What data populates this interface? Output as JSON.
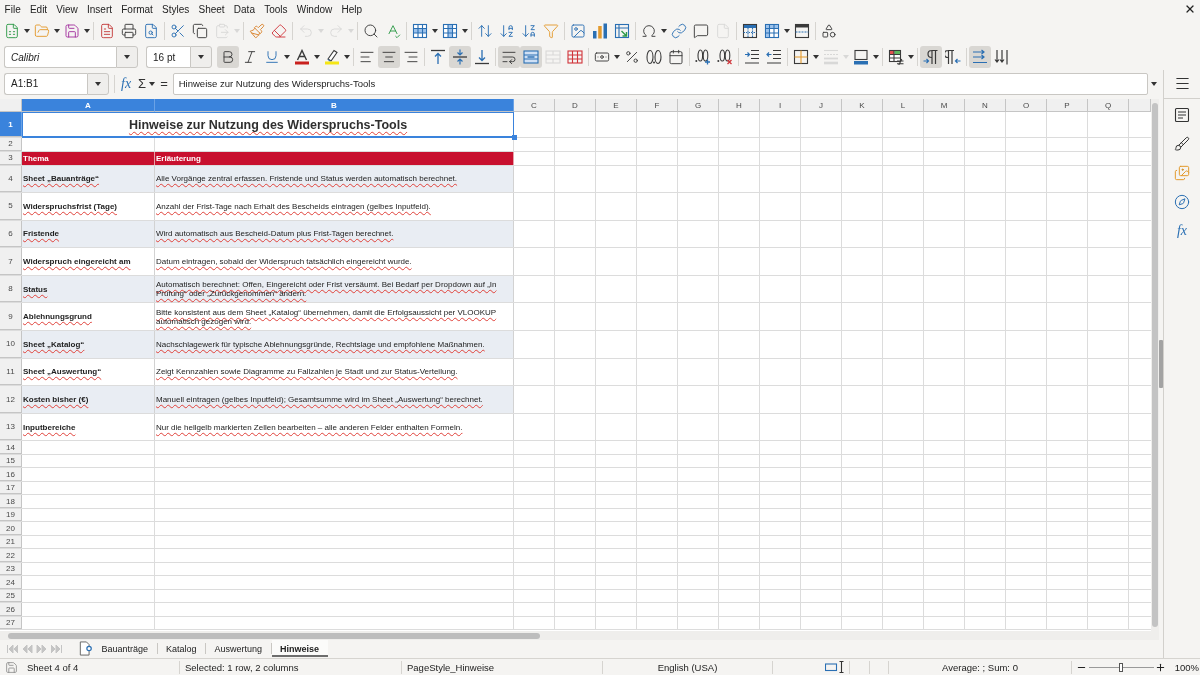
{
  "menu_bar": [
    "File",
    "Edit",
    "View",
    "Insert",
    "Format",
    "Styles",
    "Sheet",
    "Data",
    "Tools",
    "Window",
    "Help"
  ],
  "standard_toolbar": [
    {
      "disabled": false
    },
    {
      "disabled": false
    },
    {
      "disabled": false
    },
    {
      "disabled": false
    },
    {
      "disabled": false
    },
    {
      "disabled": false
    },
    {
      "disabled": false
    },
    {
      "disabled": false
    },
    {
      "disabled": true
    },
    {
      "disabled": false
    },
    {
      "disabled": false
    },
    {
      "disabled": true
    },
    {
      "disabled": true
    },
    {
      "disabled": false
    },
    {
      "disabled": false
    },
    {
      "disabled": false
    },
    {
      "disabled": false
    },
    {
      "disabled": false
    },
    {
      "disabled": false
    },
    {
      "disabled": false
    },
    {
      "disabled": false
    },
    {
      "disabled": false
    },
    {
      "disabled": false
    },
    {
      "disabled": false
    },
    {
      "disabled": false
    },
    {
      "disabled": false
    },
    {
      "disabled": false
    },
    {
      "disabled": true
    },
    {
      "disabled": false
    },
    {
      "disabled": false
    },
    {
      "disabled": false
    },
    {
      "disabled": false
    }
  ],
  "formatting_toolbar": {
    "font_name": "Calibri",
    "font_size": "16 pt",
    "buttons": [
      {
        "pressed": true,
        "disabled": false
      },
      {
        "pressed": false,
        "disabled": false
      },
      {
        "pressed": false,
        "disabled": false
      },
      {
        "pressed": false,
        "disabled": false
      },
      {
        "pressed": false,
        "disabled": false
      },
      {
        "pressed": false,
        "disabled": false
      },
      {
        "pressed": true,
        "disabled": false
      },
      {
        "pressed": false,
        "disabled": false
      },
      {
        "pressed": false,
        "disabled": false
      },
      {
        "pressed": true,
        "disabled": false
      },
      {
        "pressed": false,
        "disabled": false
      },
      {
        "pressed": true,
        "disabled": false
      },
      {
        "pressed": true,
        "disabled": false
      },
      {
        "pressed": false,
        "disabled": true
      },
      {
        "pressed": false,
        "disabled": false
      },
      {
        "pressed": false,
        "disabled": false
      },
      {
        "pressed": false,
        "disabled": false
      },
      {
        "pressed": false,
        "disabled": false
      },
      {
        "pressed": false,
        "disabled": false
      },
      {
        "pressed": false,
        "disabled": false
      },
      {
        "pressed": false,
        "disabled": false
      },
      {
        "pressed": false,
        "disabled": false
      },
      {
        "pressed": false,
        "disabled": false
      },
      {
        "pressed": false,
        "disabled": false
      },
      {
        "pressed": false,
        "disabled": true
      },
      {
        "pressed": false,
        "disabled": false
      },
      {
        "pressed": false,
        "disabled": false
      },
      {
        "pressed": true,
        "disabled": false
      },
      {
        "pressed": false,
        "disabled": false
      },
      {
        "pressed": true,
        "disabled": false
      },
      {
        "pressed": false,
        "disabled": false
      }
    ]
  },
  "formula_bar": {
    "name_box": "A1:B1",
    "function_wizard": "fx",
    "sum": "Σ",
    "equals": "=",
    "content": "Hinweise zur Nutzung des Widerspruchs-Tools"
  },
  "sheet": {
    "columns": [
      {
        "label": "A",
        "selected": true
      },
      {
        "label": "B",
        "selected": true
      },
      {
        "label": "C",
        "selected": false
      },
      {
        "label": "D",
        "selected": false
      },
      {
        "label": "E",
        "selected": false
      },
      {
        "label": "F",
        "selected": false
      },
      {
        "label": "G",
        "selected": false
      },
      {
        "label": "H",
        "selected": false
      },
      {
        "label": "I",
        "selected": false
      },
      {
        "label": "J",
        "selected": false
      },
      {
        "label": "K",
        "selected": false
      },
      {
        "label": "L",
        "selected": false
      },
      {
        "label": "M",
        "selected": false
      },
      {
        "label": "N",
        "selected": false
      },
      {
        "label": "O",
        "selected": false
      },
      {
        "label": "P",
        "selected": false
      },
      {
        "label": "Q",
        "selected": false
      }
    ],
    "rows": [
      {
        "number": "1",
        "selected": true,
        "kind": "title",
        "cells": [
          "Hinweise zur Nutzung des Widerspruchs-Tools"
        ]
      },
      {
        "number": "2",
        "selected": false,
        "kind": "blank"
      },
      {
        "number": "3",
        "selected": false,
        "kind": "header",
        "cells": [
          "Thema",
          "Erläuterung"
        ]
      },
      {
        "number": "4",
        "selected": false,
        "kind": "entry",
        "cells": [
          "Sheet „Bauanträge“",
          "Alle Vorgänge zentral erfassen. Fristende und Status werden automatisch berechnet."
        ]
      },
      {
        "number": "5",
        "selected": false,
        "kind": "entry",
        "cells": [
          "Widerspruchsfrist (Tage)",
          "Anzahl der Frist-Tage nach Erhalt des Bescheids eintragen (gelbes Inputfeld)."
        ]
      },
      {
        "number": "6",
        "selected": false,
        "kind": "entry",
        "cells": [
          "Fristende",
          "Wird automatisch aus Bescheid-Datum plus Frist-Tagen berechnet."
        ]
      },
      {
        "number": "7",
        "selected": false,
        "kind": "entry",
        "cells": [
          "Widerspruch eingereicht am",
          "Datum eintragen, sobald der Widerspruch tatsächlich eingereicht wurde."
        ]
      },
      {
        "number": "8",
        "selected": false,
        "kind": "entry",
        "cells": [
          "Status",
          "Automatisch berechnet: Offen, Eingereicht oder Frist versäumt. Bei Bedarf per Dropdown auf „In Prüfung“ oder „Zurückgenommen“ ändern."
        ]
      },
      {
        "number": "9",
        "selected": false,
        "kind": "entry",
        "cells": [
          "Ablehnungsgrund",
          "Bitte konsistent aus dem Sheet „Katalog“ übernehmen, damit die Erfolgsaussicht per VLOOKUP automatisch gezogen wird."
        ]
      },
      {
        "number": "10",
        "selected": false,
        "kind": "entry",
        "cells": [
          "Sheet „Katalog“",
          "Nachschlagewerk für typische Ablehnungsgründe, Rechtslage und empfohlene Maßnahmen."
        ]
      },
      {
        "number": "11",
        "selected": false,
        "kind": "entry",
        "cells": [
          "Sheet „Auswertung“",
          "Zeigt Kennzahlen sowie Diagramme zu Fallzahlen je Stadt und zur Status-Verteilung."
        ]
      },
      {
        "number": "12",
        "selected": false,
        "kind": "entry",
        "cells": [
          "Kosten bisher (€)",
          "Manuell eintragen (gelbes Inputfeld); Gesamtsumme wird im Sheet „Auswertung“ berechnet."
        ]
      },
      {
        "number": "13",
        "selected": false,
        "kind": "entry",
        "cells": [
          "Inputbereiche",
          "Nur die hellgelb markierten Zellen bearbeiten – alle anderen Felder enthalten Formeln."
        ]
      },
      {
        "number": "14",
        "selected": false,
        "kind": "blank"
      },
      {
        "number": "15",
        "selected": false,
        "kind": "blank"
      },
      {
        "number": "16",
        "selected": false,
        "kind": "blank"
      },
      {
        "number": "17",
        "selected": false,
        "kind": "blank"
      },
      {
        "number": "18",
        "selected": false,
        "kind": "blank"
      },
      {
        "number": "19",
        "selected": false,
        "kind": "blank"
      },
      {
        "number": "20",
        "selected": false,
        "kind": "blank"
      },
      {
        "number": "21",
        "selected": false,
        "kind": "blank"
      },
      {
        "number": "22",
        "selected": false,
        "kind": "blank"
      },
      {
        "number": "23",
        "selected": false,
        "kind": "blank"
      },
      {
        "number": "24",
        "selected": false,
        "kind": "blank"
      },
      {
        "number": "25",
        "selected": false,
        "kind": "blank"
      },
      {
        "number": "26",
        "selected": false,
        "kind": "blank"
      },
      {
        "number": "27",
        "selected": false,
        "kind": "blank"
      }
    ]
  },
  "sheet_tabs": {
    "navigation": [
      {
        "disabled": true
      },
      {
        "disabled": true
      },
      {
        "disabled": true
      },
      {
        "disabled": true
      }
    ],
    "tabs": [
      {
        "label": "Bauanträge",
        "selected": false
      },
      {
        "label": "Katalog",
        "selected": false
      },
      {
        "label": "Auswertung",
        "selected": false
      },
      {
        "label": "Hinweise",
        "selected": true
      }
    ]
  },
  "sidebar": {
    "functions_label": "fx"
  },
  "status_bar": {
    "sheet": "Sheet 4 of 4",
    "selection": "Selected: 1 row, 2 columns",
    "page_style": "PageStyle_Hinweise",
    "language": "English (USA)",
    "summary": "Average: ; Sum: 0",
    "zoom": {
      "level": 0.5,
      "percent": "100%"
    }
  }
}
